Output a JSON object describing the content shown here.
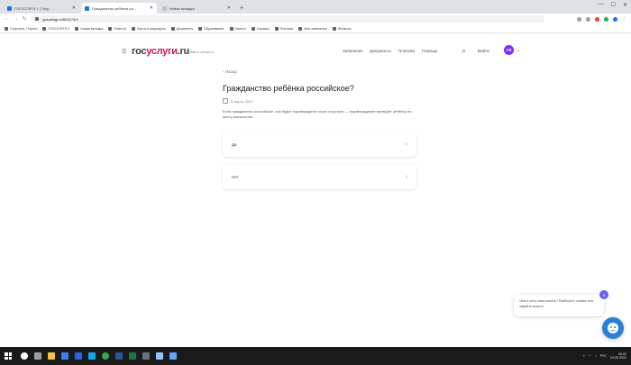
{
  "browser": {
    "tabs": [
      {
        "title": "ГОСУСЛУГИ 1 | Госу...",
        "active": false
      },
      {
        "title": "Гражданство ребёнка ро...",
        "active": true
      },
      {
        "title": "Новая вкладка",
        "active": false
      }
    ],
    "address": "gosuslugi.ru/600174/1",
    "bookmarks": [
      "Госуслуги. Портал",
      "ГОСУСЛУГИ 1",
      "Новая вкладка",
      "Новости",
      "Карты и маршруты",
      "Документы",
      "Образование",
      "Налоги",
      "Справки",
      "Платежи",
      "Мои заявления",
      "Финансы"
    ]
  },
  "site": {
    "logo_main": "гос",
    "logo_accent": "услуги",
    "logo_suffix": ".ru",
    "region": "Москва и область",
    "nav": [
      "Заявления",
      "Документы",
      "Платежи",
      "Помощь"
    ],
    "login": "Войти",
    "avatar_initials": "АК"
  },
  "page": {
    "back": "‹ Назад",
    "title": "Гражданство ребёнка российское?",
    "date": "5 марта 2021",
    "description": "Если гражданство российское, оно будет подтверждено через госуслуги — подтверждение проведёт ребёнку по месту жительства",
    "options": [
      {
        "label": "Да"
      },
      {
        "label": "Нет"
      }
    ]
  },
  "chat": {
    "bubble_text": "Чем я могу вам помочь? Выберите сервис или задайте вопрос",
    "badge_count": "1"
  },
  "taskbar": {
    "clock_time": "16:02",
    "clock_date": "24.05.2021",
    "lang": "РУС"
  },
  "colors": {
    "accent": "#d4145a",
    "avatar": "#7b2ff7",
    "chat": "#2b7fd8"
  }
}
